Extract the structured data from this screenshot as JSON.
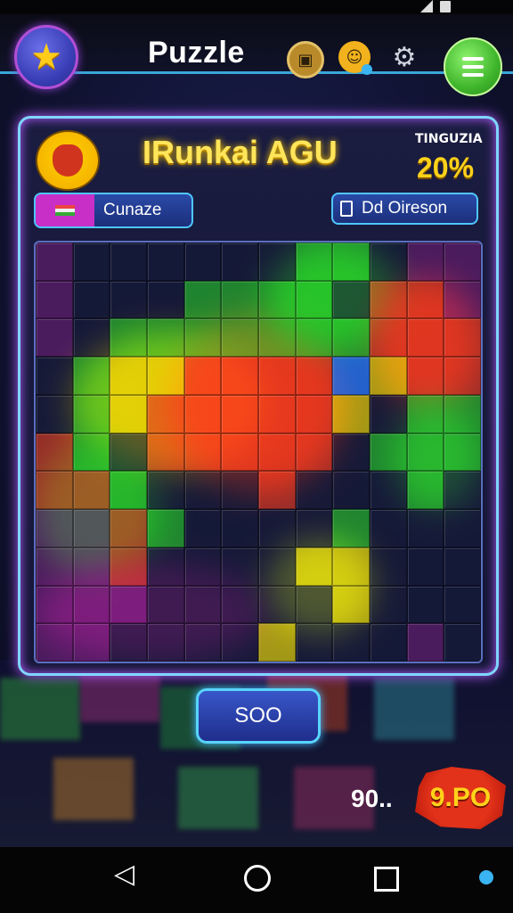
{
  "app": {
    "title": "Puzzle"
  },
  "header_icons": [
    "star-icon",
    "map-icon",
    "character-icon",
    "gear-icon",
    "menu-icon"
  ],
  "player": {
    "name": "IRunkai AGU",
    "progress_label": "TINGUZIA",
    "progress_value": "20%"
  },
  "buttons": {
    "change_label": "Cunaze",
    "opponent_label": "Dd Oireson",
    "start_label": "SOO"
  },
  "currency": {
    "coins": "90..",
    "gems": "9.PO"
  },
  "colors": {
    "accent": "#7fd6ff",
    "title_yellow": "#ffe55a",
    "start_blue": "#3856c9",
    "gem_red": "#e2321a"
  },
  "navigation": [
    "back-icon",
    "home-icon",
    "recents-icon"
  ]
}
